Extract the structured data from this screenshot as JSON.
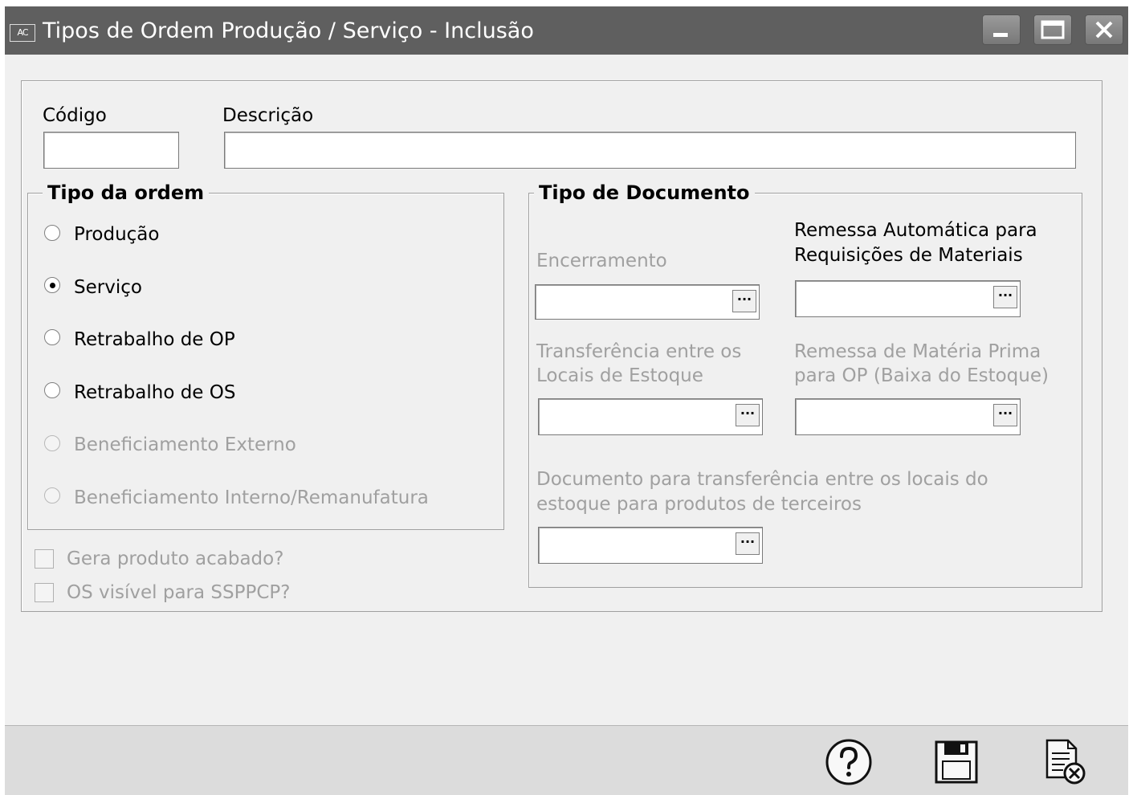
{
  "window": {
    "app_icon": "AC",
    "title": "Tipos de Ordem Produção / Serviço - Inclusão",
    "controls": [
      "minimize-icon",
      "maximize-icon",
      "close-icon"
    ]
  },
  "form": {
    "codigo_label": "Código",
    "codigo_value": "",
    "descricao_label": "Descrição",
    "descricao_value": ""
  },
  "tipo_ordem": {
    "legend": "Tipo da ordem",
    "options": [
      {
        "label": "Produção",
        "selected": false,
        "enabled": true
      },
      {
        "label": "Serviço",
        "selected": true,
        "enabled": true
      },
      {
        "label": "Retrabalho de OP",
        "selected": false,
        "enabled": true
      },
      {
        "label": "Retrabalho de OS",
        "selected": false,
        "enabled": true
      },
      {
        "label": "Beneficiamento Externo",
        "selected": false,
        "enabled": false
      },
      {
        "label": "Beneficiamento Interno/Remanufatura",
        "selected": false,
        "enabled": false
      }
    ]
  },
  "checkboxes": [
    {
      "label": "Gera produto acabado?",
      "checked": false,
      "enabled": false
    },
    {
      "label": "OS visível para SSPPCP?",
      "checked": false,
      "enabled": false
    }
  ],
  "tipo_documento": {
    "legend": "Tipo de Documento",
    "encerramento_label": "Encerramento",
    "remessa_auto_label_1": "Remessa Automática para",
    "remessa_auto_label_2": "Requisições de Materiais",
    "transferencia_label_1": "Transferência entre os",
    "transferencia_label_2": "Locais de Estoque",
    "remessa_mp_label_1": "Remessa de Matéria Prima",
    "remessa_mp_label_2": "para OP (Baixa do Estoque)",
    "doc_terceiros_label_1": "Documento para transferência entre os locais do",
    "doc_terceiros_label_2": "estoque para produtos de terceiros",
    "lookup_button": "···"
  },
  "footer": {
    "buttons": [
      "help-icon",
      "save-icon",
      "cancel-document-icon"
    ]
  },
  "colors": {
    "titlebar": "#5f5f5f",
    "background": "#f0f0f0",
    "disabled_text": "#a0a0a0",
    "footer": "#dcdcdc"
  }
}
